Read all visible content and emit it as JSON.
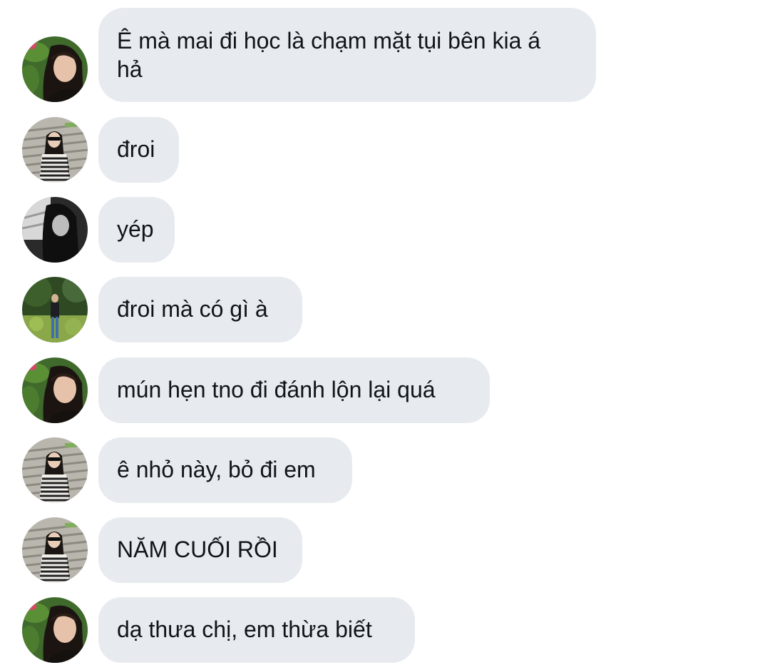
{
  "messages": [
    {
      "sender_avatar": "avatar-girl-plants",
      "text": "Ê mà mai đi học là chạm mặt tụi bên kia á hả"
    },
    {
      "sender_avatar": "avatar-girl-stairs",
      "text": "đroi"
    },
    {
      "sender_avatar": "avatar-girl-bw",
      "text": "yép"
    },
    {
      "sender_avatar": "avatar-boy-garden",
      "text": "đroi mà có gì à"
    },
    {
      "sender_avatar": "avatar-girl-plants",
      "text": "mún hẹn tno đi đánh lộn lại quá"
    },
    {
      "sender_avatar": "avatar-girl-stairs",
      "text": "ê nhỏ này, bỏ đi em"
    },
    {
      "sender_avatar": "avatar-girl-stairs",
      "text": "NĂM CUỐI RỒI"
    },
    {
      "sender_avatar": "avatar-girl-plants",
      "text": "dạ thưa chị, em thừa biết"
    }
  ],
  "colors": {
    "background": "#ffffff",
    "bubble": "#e7ebef",
    "text": "#111418"
  }
}
